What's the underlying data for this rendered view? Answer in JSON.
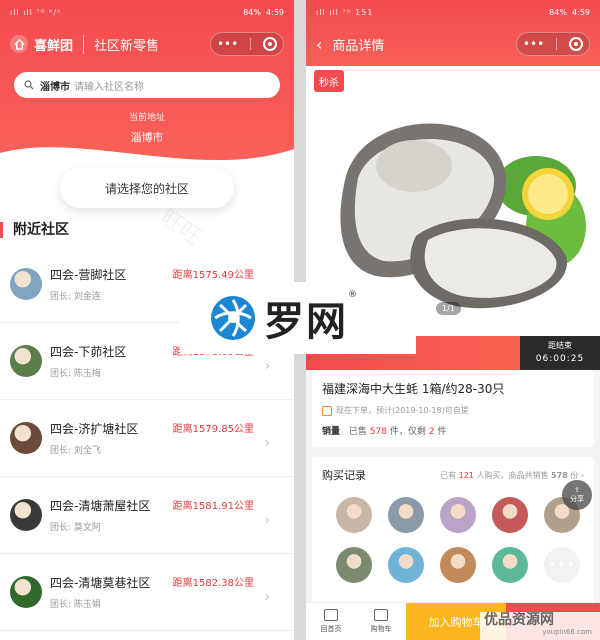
{
  "left": {
    "status": {
      "signal": "ıll ıll ⁷ᴳ ᴷ/ˢ",
      "battery": "84%",
      "time": "4:59"
    },
    "brand": "喜鲜团",
    "subtitle": "社区新零售",
    "search": {
      "city": "淄博市",
      "placeholder": "请输入社区名称"
    },
    "location_label": "当前地址",
    "location_value": "淄博市",
    "choose_label": "请选择您的社区",
    "nearby_title": "附近社区",
    "communities": [
      {
        "name": "四会-营脚社区",
        "leader": "团长: 刘金连",
        "distance": "距离1575.49公里",
        "color": "#7fa5c2"
      },
      {
        "name": "四会-下茆社区",
        "leader": "团长: 陈玉梅",
        "distance": "距离1578.09公里",
        "color": "#5a7e4a"
      },
      {
        "name": "四会-济扩塘社区",
        "leader": "团长: 刘全飞",
        "distance": "距离1579.85公里",
        "color": "#6b4a3a"
      },
      {
        "name": "四会-清塘萧屋社区",
        "leader": "团长: 莫文阿",
        "distance": "距离1581.91公里",
        "color": "#3a3a3a"
      },
      {
        "name": "四会-清塘莫巷社区",
        "leader": "团长: 陈玉娟",
        "distance": "距离1582.38公里",
        "color": "#2f6a2c"
      }
    ]
  },
  "right": {
    "status": {
      "signal": "ıll ıll ⁷ᴳ 151",
      "battery": "84%",
      "time": "4:59"
    },
    "title": "商品详情",
    "seckill": "秒杀",
    "pager": "1/1",
    "countdown_label": "距结束",
    "countdown_time": "06:00:25",
    "product_title": "福建深海中大生蚝  1箱/约28-30只",
    "product_note": "现在下单，预计(2019-10-18)可自提",
    "sales_label": "销量",
    "sales_sold_prefix": "已售",
    "sales_sold": "578",
    "sales_sold_suffix": "件，仅剩",
    "sales_left": "2",
    "sales_left_suffix": "件",
    "records_title": "购买记录",
    "records_stat_prefix": "已有",
    "records_people": "121",
    "records_stat_mid": "人购买，商品共销售",
    "records_total": "578",
    "records_stat_suffix": "份",
    "buyers": [
      "#c9b6a6",
      "#8a9aa8",
      "#b9a4c7",
      "#c45a5a",
      "#b3a08a",
      "#7b8a6e",
      "#6fb3d9",
      "#c28a5a",
      "#5cb89a"
    ],
    "more": "•••",
    "share": "分享",
    "tabs": {
      "home": "回首页",
      "cart": "购物车",
      "add_cart": "加入购物车"
    }
  },
  "logo": {
    "text": "罗网",
    "reg": "®"
  },
  "watermark": {
    "text": "优品资源网",
    "url": "youpin66.com"
  }
}
